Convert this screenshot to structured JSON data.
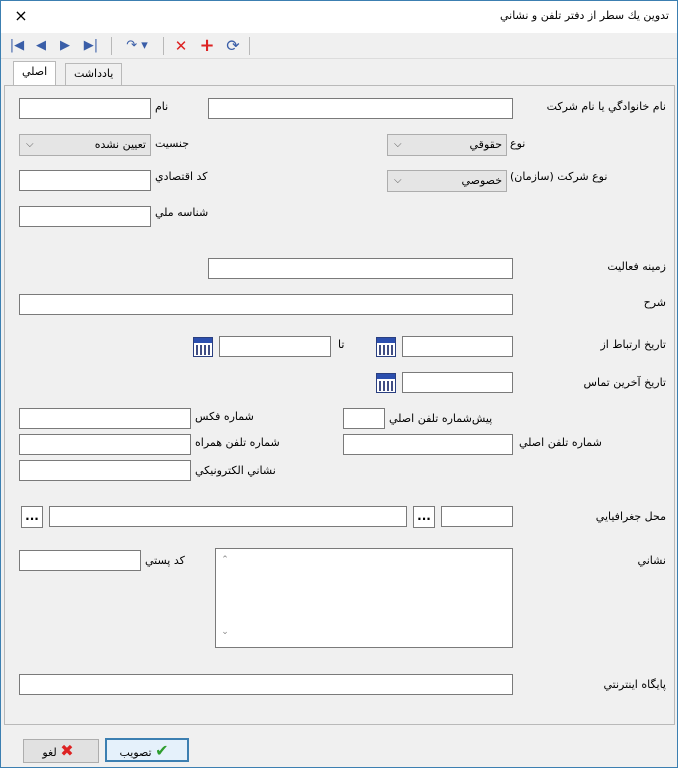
{
  "window": {
    "title": "تدوين يك سطر از دفتر تلفن و نشاني",
    "close_icon": "×"
  },
  "toolbar": {
    "first_icon": "|◀",
    "prev_icon": "◀",
    "next_icon": "▶",
    "last_icon": "▶|",
    "refresh_menu_icon": "↷ ▾",
    "delete_icon": "✕",
    "add_icon": "+",
    "reload_icon": "⟳"
  },
  "tabs": [
    {
      "label": "اصلي"
    },
    {
      "label": "يادداشت"
    }
  ],
  "form": {
    "family_name_label": "نام خانوادگي يا نام شركت",
    "first_name_label": "نام",
    "type_label": "نوع",
    "type_value": "حقوقي",
    "gender_label": "جنسيت",
    "gender_value": "تعيين نشده",
    "company_type_label": "نوع شركت (سازمان)",
    "company_type_value": "خصوصي",
    "economic_code_label": "كد اقتصادي",
    "national_id_label": "شناسه ملي",
    "activity_label": "زمينه فعاليت",
    "description_label": "شرح",
    "contact_from_label": "تاريخ ارتباط از",
    "to_label": "تا",
    "last_contact_label": "تاريخ آخرين تماس",
    "main_phone_prefix_label": "پيش‌شماره تلفن اصلي",
    "fax_label": "شماره فكس",
    "main_phone_label": "شماره تلفن اصلي",
    "mobile_label": "شماره تلفن همراه",
    "email_label": "نشاني الكترونيكي",
    "location_label": "محل جغرافيايي",
    "address_label": "نشاني",
    "postal_code_label": "كد پستي",
    "website_label": "پايگاه اينترنتي",
    "ellipsis": "..."
  },
  "buttons": {
    "approve_label": "تصويب",
    "cancel_label": "لغو"
  }
}
